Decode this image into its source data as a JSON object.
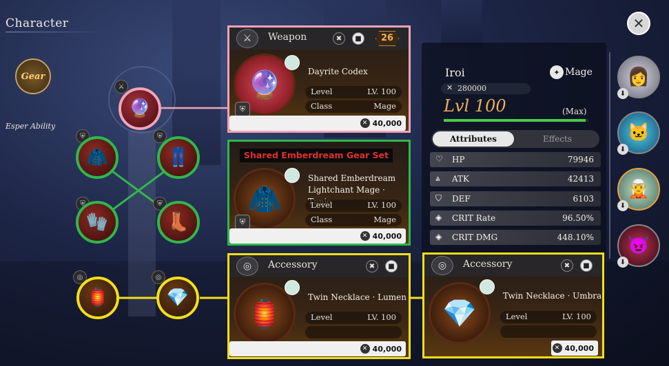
{
  "header": {
    "title": "Character",
    "close_icon": "✕"
  },
  "left_rail": {
    "gear_tab": "Gear",
    "esper_ability": "Esper Ability"
  },
  "icons": {
    "weapon": "⚔",
    "accessory": "◎",
    "trash": "🗑",
    "lock": "🔒",
    "shield": "⛨",
    "coin": "✕",
    "download": "⬇",
    "mage": "✦",
    "hp": "♡",
    "atk": "⩓",
    "def": "⛉",
    "crit": "◈"
  },
  "weapon_card": {
    "category": "Weapon",
    "badge": "26",
    "name": "Dayrite Codex",
    "level_label": "Level",
    "level_value": "LV. 100",
    "class_label": "Class",
    "class_value": "Mage",
    "price": "40,000"
  },
  "set_banner": "Shared Emberdream Gear Set",
  "armor_card": {
    "name_line1": "Shared Emberdream",
    "name_line2": "Lightchant Mage · Tunic",
    "level_label": "Level",
    "level_value": "LV. 100",
    "class_label": "Class",
    "class_value": "Mage",
    "price": "40,000"
  },
  "accessory_card_1": {
    "category": "Accessory",
    "name": "Twin Necklace · Lumen",
    "level_label": "Level",
    "level_value": "LV. 100",
    "price": "40,000"
  },
  "accessory_card_2": {
    "category": "Accessory",
    "name": "Twin Necklace · Umbra",
    "level_label": "Level",
    "level_value": "LV. 100",
    "price": "40,000"
  },
  "character": {
    "name": "Iroi",
    "class": "Mage",
    "power": "280000",
    "level": "Lvl 100",
    "max_label": "(Max)",
    "exp_fill": 0.98,
    "tab_attributes": "Attributes",
    "tab_effects": "Effects",
    "stats": [
      {
        "label": "HP",
        "value": "79946",
        "icon": "hp"
      },
      {
        "label": "ATK",
        "value": "42413",
        "icon": "atk"
      },
      {
        "label": "DEF",
        "value": "6103",
        "icon": "def"
      },
      {
        "label": "CRIT Rate",
        "value": "96.50%",
        "icon": "crit"
      },
      {
        "label": "CRIT DMG",
        "value": "448.10%",
        "icon": "crit"
      }
    ]
  },
  "colors": {
    "weapon_outline": "#f2a4b8",
    "armor_outline": "#2fb84a",
    "accessory_outline": "#f3df1a",
    "level_gold": "#e8b25a",
    "exp_bar": "#4ec84a"
  }
}
